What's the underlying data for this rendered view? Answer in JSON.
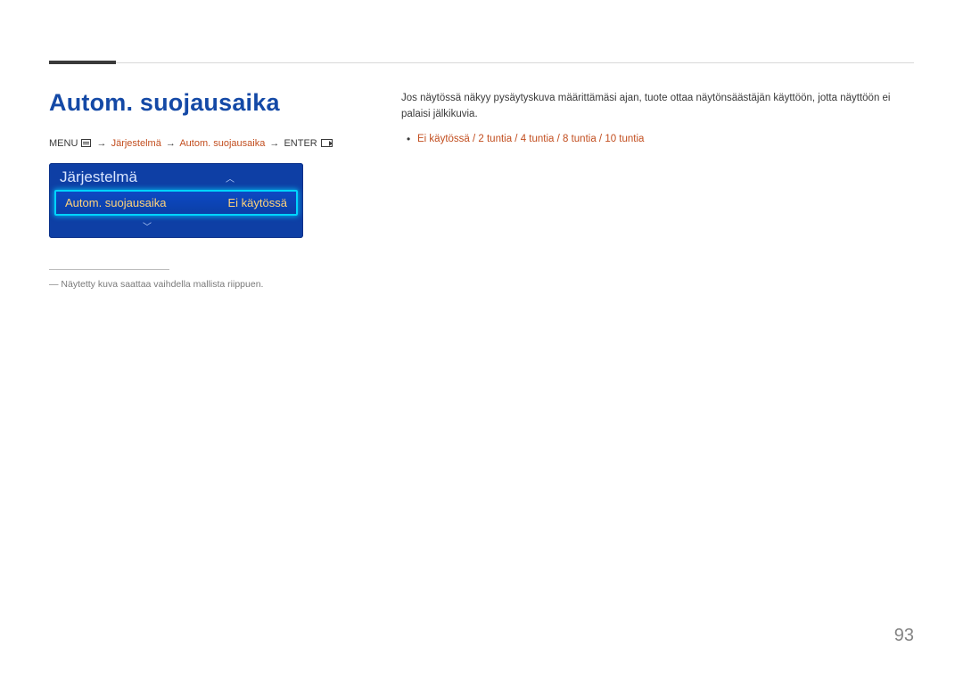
{
  "page_title": "Autom. suojausaika",
  "menu_path": {
    "prefix": "MENU",
    "seg1": "Järjestelmä",
    "seg2": "Autom. suojausaika",
    "suffix": "ENTER"
  },
  "osd": {
    "header": "Järjestelmä",
    "row_label": "Autom. suojausaika",
    "row_value": "Ei käytössä"
  },
  "note": "― Näytetty kuva saattaa vaihdella mallista riippuen.",
  "body": "Jos näytössä näkyy pysäytyskuva määrittämäsi ajan, tuote ottaa näytönsäästäjän käyttöön, jotta näyttöön ei palaisi jälkikuvia.",
  "options": "Ei käytössä / 2 tuntia / 4 tuntia / 8 tuntia / 10 tuntia",
  "page_number": "93"
}
